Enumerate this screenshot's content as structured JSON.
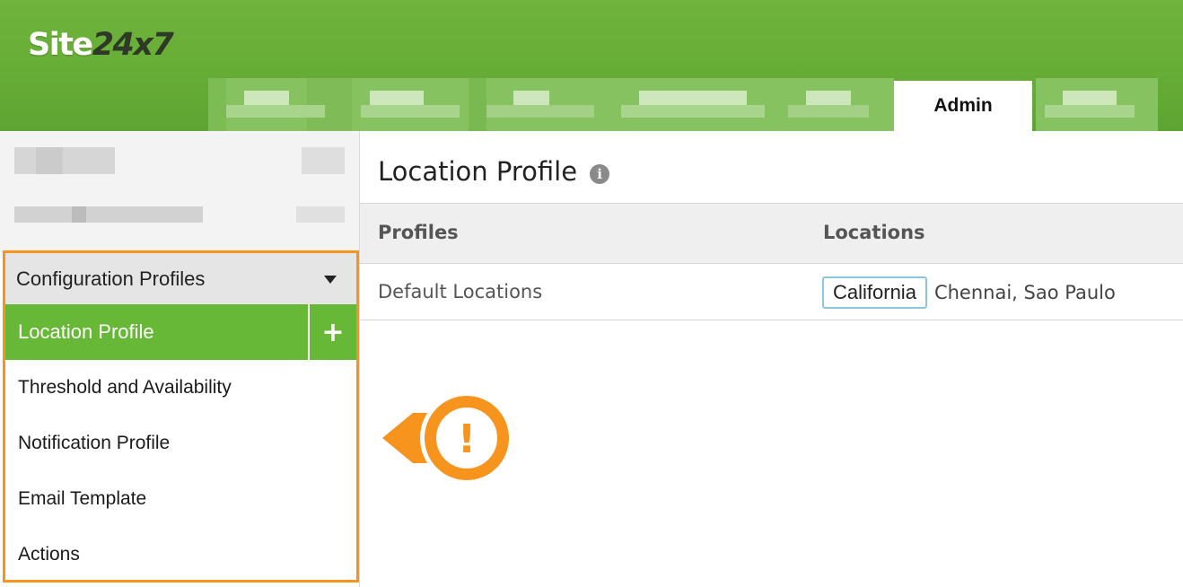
{
  "app": {
    "logo_part1": "Site",
    "logo_part2": "24x7"
  },
  "header": {
    "tabs": [
      {
        "label": "",
        "state": "redacted"
      },
      {
        "label": "",
        "state": "redacted"
      },
      {
        "label": "",
        "state": "redacted"
      },
      {
        "label": "",
        "state": "redacted"
      },
      {
        "label": "",
        "state": "redacted"
      },
      {
        "label": "Admin",
        "state": "active"
      },
      {
        "label": "",
        "state": "redacted"
      }
    ]
  },
  "sidebar": {
    "section_title": "Configuration Profiles",
    "section_icon": "caret-down-icon",
    "items": [
      {
        "label": "Location Profile",
        "active": true
      },
      {
        "label": "Threshold and Availability"
      },
      {
        "label": "Notification Profile"
      },
      {
        "label": "Email Template"
      },
      {
        "label": "Actions"
      }
    ],
    "add_icon_glyph": "+"
  },
  "main": {
    "title": "Location Profile",
    "info_icon_glyph": "i",
    "table": {
      "headers": [
        "Profiles",
        "Locations"
      ],
      "rows": [
        {
          "profile": "Default Locations",
          "highlighted_location": "California",
          "other_locations": "Chennai, Sao Paulo"
        }
      ]
    }
  },
  "callout": {
    "icon": "warning-exclamation-icon",
    "glyph": "!"
  },
  "colors": {
    "header_green": "#66ad36",
    "active_green": "#66b836",
    "highlight_orange": "#f7941d",
    "chip_border": "#8dc6e4"
  }
}
